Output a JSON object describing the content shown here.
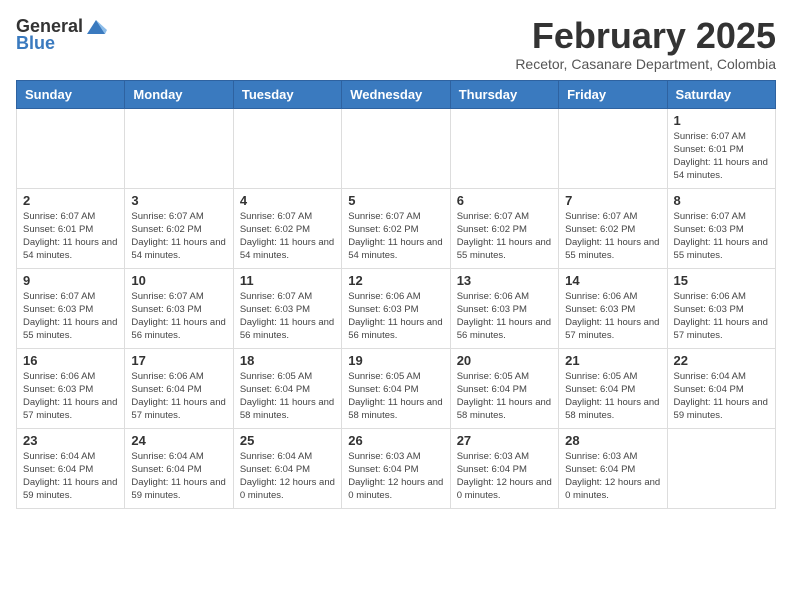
{
  "logo": {
    "general": "General",
    "blue": "Blue"
  },
  "header": {
    "month": "February 2025",
    "location": "Recetor, Casanare Department, Colombia"
  },
  "days_of_week": [
    "Sunday",
    "Monday",
    "Tuesday",
    "Wednesday",
    "Thursday",
    "Friday",
    "Saturday"
  ],
  "weeks": [
    [
      {
        "day": "",
        "info": ""
      },
      {
        "day": "",
        "info": ""
      },
      {
        "day": "",
        "info": ""
      },
      {
        "day": "",
        "info": ""
      },
      {
        "day": "",
        "info": ""
      },
      {
        "day": "",
        "info": ""
      },
      {
        "day": "1",
        "info": "Sunrise: 6:07 AM\nSunset: 6:01 PM\nDaylight: 11 hours and 54 minutes."
      }
    ],
    [
      {
        "day": "2",
        "info": "Sunrise: 6:07 AM\nSunset: 6:01 PM\nDaylight: 11 hours and 54 minutes."
      },
      {
        "day": "3",
        "info": "Sunrise: 6:07 AM\nSunset: 6:02 PM\nDaylight: 11 hours and 54 minutes."
      },
      {
        "day": "4",
        "info": "Sunrise: 6:07 AM\nSunset: 6:02 PM\nDaylight: 11 hours and 54 minutes."
      },
      {
        "day": "5",
        "info": "Sunrise: 6:07 AM\nSunset: 6:02 PM\nDaylight: 11 hours and 54 minutes."
      },
      {
        "day": "6",
        "info": "Sunrise: 6:07 AM\nSunset: 6:02 PM\nDaylight: 11 hours and 55 minutes."
      },
      {
        "day": "7",
        "info": "Sunrise: 6:07 AM\nSunset: 6:02 PM\nDaylight: 11 hours and 55 minutes."
      },
      {
        "day": "8",
        "info": "Sunrise: 6:07 AM\nSunset: 6:03 PM\nDaylight: 11 hours and 55 minutes."
      }
    ],
    [
      {
        "day": "9",
        "info": "Sunrise: 6:07 AM\nSunset: 6:03 PM\nDaylight: 11 hours and 55 minutes."
      },
      {
        "day": "10",
        "info": "Sunrise: 6:07 AM\nSunset: 6:03 PM\nDaylight: 11 hours and 56 minutes."
      },
      {
        "day": "11",
        "info": "Sunrise: 6:07 AM\nSunset: 6:03 PM\nDaylight: 11 hours and 56 minutes."
      },
      {
        "day": "12",
        "info": "Sunrise: 6:06 AM\nSunset: 6:03 PM\nDaylight: 11 hours and 56 minutes."
      },
      {
        "day": "13",
        "info": "Sunrise: 6:06 AM\nSunset: 6:03 PM\nDaylight: 11 hours and 56 minutes."
      },
      {
        "day": "14",
        "info": "Sunrise: 6:06 AM\nSunset: 6:03 PM\nDaylight: 11 hours and 57 minutes."
      },
      {
        "day": "15",
        "info": "Sunrise: 6:06 AM\nSunset: 6:03 PM\nDaylight: 11 hours and 57 minutes."
      }
    ],
    [
      {
        "day": "16",
        "info": "Sunrise: 6:06 AM\nSunset: 6:03 PM\nDaylight: 11 hours and 57 minutes."
      },
      {
        "day": "17",
        "info": "Sunrise: 6:06 AM\nSunset: 6:04 PM\nDaylight: 11 hours and 57 minutes."
      },
      {
        "day": "18",
        "info": "Sunrise: 6:05 AM\nSunset: 6:04 PM\nDaylight: 11 hours and 58 minutes."
      },
      {
        "day": "19",
        "info": "Sunrise: 6:05 AM\nSunset: 6:04 PM\nDaylight: 11 hours and 58 minutes."
      },
      {
        "day": "20",
        "info": "Sunrise: 6:05 AM\nSunset: 6:04 PM\nDaylight: 11 hours and 58 minutes."
      },
      {
        "day": "21",
        "info": "Sunrise: 6:05 AM\nSunset: 6:04 PM\nDaylight: 11 hours and 58 minutes."
      },
      {
        "day": "22",
        "info": "Sunrise: 6:04 AM\nSunset: 6:04 PM\nDaylight: 11 hours and 59 minutes."
      }
    ],
    [
      {
        "day": "23",
        "info": "Sunrise: 6:04 AM\nSunset: 6:04 PM\nDaylight: 11 hours and 59 minutes."
      },
      {
        "day": "24",
        "info": "Sunrise: 6:04 AM\nSunset: 6:04 PM\nDaylight: 11 hours and 59 minutes."
      },
      {
        "day": "25",
        "info": "Sunrise: 6:04 AM\nSunset: 6:04 PM\nDaylight: 12 hours and 0 minutes."
      },
      {
        "day": "26",
        "info": "Sunrise: 6:03 AM\nSunset: 6:04 PM\nDaylight: 12 hours and 0 minutes."
      },
      {
        "day": "27",
        "info": "Sunrise: 6:03 AM\nSunset: 6:04 PM\nDaylight: 12 hours and 0 minutes."
      },
      {
        "day": "28",
        "info": "Sunrise: 6:03 AM\nSunset: 6:04 PM\nDaylight: 12 hours and 0 minutes."
      },
      {
        "day": "",
        "info": ""
      }
    ]
  ]
}
